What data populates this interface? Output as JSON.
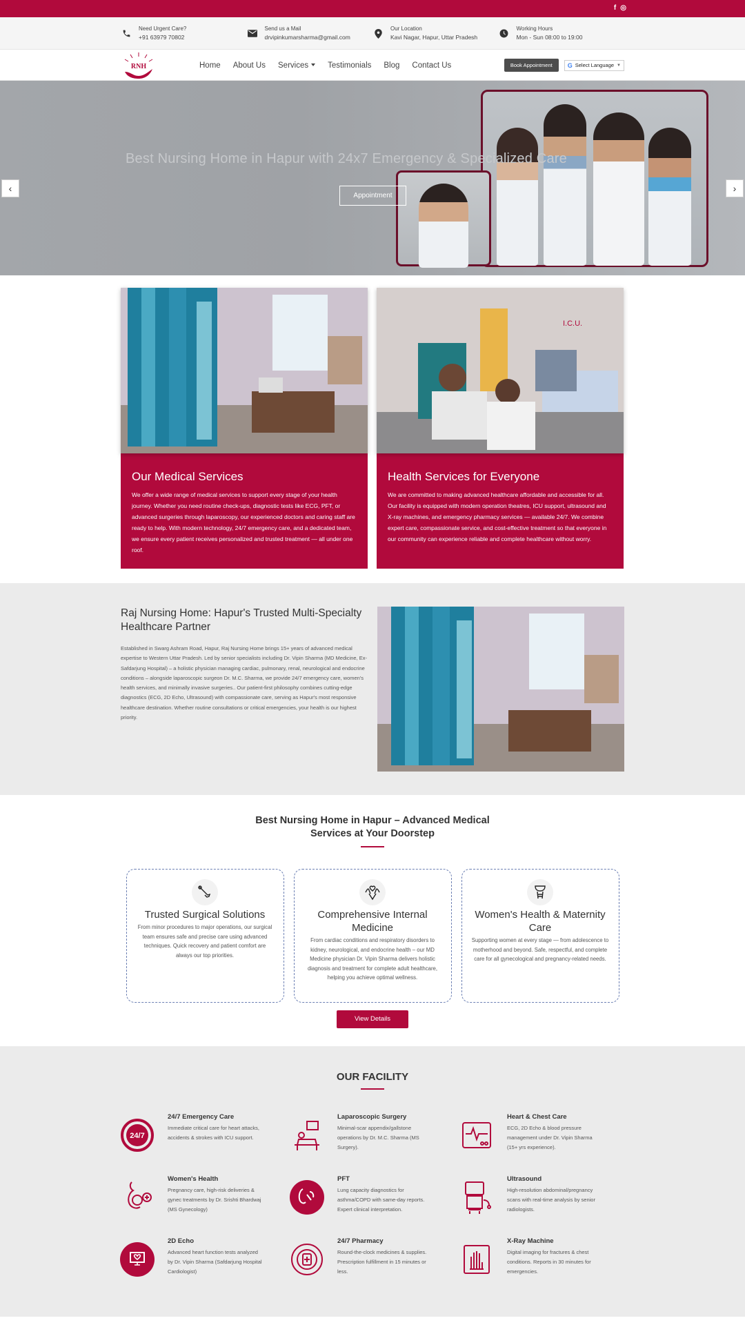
{
  "social": {
    "facebook": "f",
    "instagram": "◎"
  },
  "info": [
    {
      "title": "Need Urgent Care?",
      "value": "+91 63979 70802",
      "icon": "phone-icon"
    },
    {
      "title": "Send us a Mail",
      "value": "drvipinkumarsharma@gmail.com",
      "icon": "mail-icon"
    },
    {
      "title": "Our Location",
      "value": "Kavi Nagar, Hapur, Uttar Pradesh",
      "icon": "location-icon"
    },
    {
      "title": "Working Hours",
      "value": "Mon - Sun 08:00 to 19:00",
      "icon": "clock-icon"
    }
  ],
  "nav": {
    "logo_text": "RNH",
    "items": [
      "Home",
      "About Us",
      "Services",
      "Testimonials",
      "Blog",
      "Contact Us"
    ],
    "book": "Book Appointment",
    "lang": "Select Language",
    "lang_arrow": "▼"
  },
  "hero": {
    "title": "Best Nursing Home in Hapur with 24x7 Emergency & Specialized Care",
    "button": "Appointment",
    "prev": "‹",
    "next": "›"
  },
  "cards": [
    {
      "title": "Our Medical Services",
      "text": "We offer a wide range of medical services to support every stage of your health journey. Whether you need routine check-ups, diagnostic tests like ECG, PFT, or advanced surgeries through laparoscopy, our experienced doctors and caring staff are ready to help. With modern technology, 24/7 emergency care, and a dedicated team, we ensure every patient receives personalized and trusted treatment — all under one roof."
    },
    {
      "title": "Health Services for Everyone",
      "text": "We are committed to making advanced healthcare affordable and accessible for all. Our facility is equipped with modern operation theatres, ICU support, ultrasound and X-ray machines, and emergency pharmacy services — available 24/7. We combine expert care, compassionate service, and cost-effective treatment so that everyone in our community can experience reliable and complete healthcare without worry."
    }
  ],
  "about": {
    "title": "Raj Nursing Home: Hapur's Trusted Multi-Specialty Healthcare Partner",
    "text": "Established in Swarg Ashram Road, Hapur, Raj Nursing Home brings 15+ years of advanced medical expertise to Western Uttar Pradesh. Led by senior specialists including Dr. Vipin Sharma (MD Medicine, Ex-Safdarjung Hospital) – a holistic physician managing cardiac, pulmonary, renal, neurological and endocrine conditions – alongside laparoscopic surgeon Dr. M.C. Sharma, we provide 24/7 emergency care, women's health services, and minimally invasive surgeries.. Our patient-first philosophy combines cutting-edge diagnostics (ECG, 2D Echo, Ultrasound) with compassionate care, serving as Hapur's most responsive healthcare destination. Whether routine consultations or critical emergencies, your health is our highest priority."
  },
  "services": {
    "title": "Best Nursing Home in Hapur – Advanced Medical Services at Your Doorstep",
    "items": [
      {
        "title": "Trusted Surgical Solutions",
        "text": "From minor procedures to major operations, our surgical team ensures safe and precise care using advanced techniques. Quick recovery and patient comfort are always our top priorities.",
        "icon": "scalpel-icon"
      },
      {
        "title": "Comprehensive Internal Medicine",
        "text": "From cardiac conditions and respiratory disorders to kidney, neurological, and endocrine health – our MD Medicine physician Dr. Vipin Sharma delivers holistic diagnosis and treatment for complete adult healthcare, helping you achieve optimal wellness.",
        "icon": "hands-care-icon"
      },
      {
        "title": "Women's Health & Maternity Care",
        "text": "Supporting women at every stage — from adolescence to motherhood and beyond. Safe, respectful, and complete care for all gynecological and pregnancy-related needs.",
        "icon": "tooth-icon"
      }
    ],
    "button": "View Details"
  },
  "facility": {
    "title": "OUR FACILITY",
    "items": [
      {
        "title": "24/7 Emergency Care",
        "text": "Immediate critical care for heart attacks, accidents & strokes with ICU support.",
        "icon": "emergency-247-icon"
      },
      {
        "title": "Laparoscopic Surgery",
        "text": "Minimal-scar appendix/gallstone operations by Dr. M.C. Sharma (MS Surgery).",
        "icon": "surgery-icon"
      },
      {
        "title": "Heart & Chest Care",
        "text": "ECG, 2D Echo & blood pressure management under Dr. Vipin Sharma (15+ yrs experience).",
        "icon": "ecg-monitor-icon"
      },
      {
        "title": "Women's Health",
        "text": "Pregnancy care, high-risk deliveries & gynec treatments by Dr. Srishti Bhardwaj (MS Gynecology)",
        "icon": "pregnancy-icon"
      },
      {
        "title": "PFT",
        "text": "Lung capacity diagnostics for asthma/COPD with same-day reports. Expert clinical interpretation.",
        "icon": "lungs-icon"
      },
      {
        "title": "Ultrasound",
        "text": "High-resolution abdominal/pregnancy scans with real-time analysis by senior radiologists.",
        "icon": "ultrasound-machine-icon"
      },
      {
        "title": "2D Echo",
        "text": "Advanced heart function tests analyzed by Dr. Vipin Sharma (Safdarjung Hospital Cardiologist)",
        "icon": "heart-monitor-icon"
      },
      {
        "title": "24/7 Pharmacy",
        "text": "Round-the-clock medicines & supplies. Prescription fulfillment in 15 minutes or less.",
        "icon": "pharmacy-icon"
      },
      {
        "title": "X-Ray Machine",
        "text": "Digital imaging for fractures & chest conditions. Reports in 30 minutes for emergencies.",
        "icon": "xray-icon"
      }
    ]
  },
  "colors": {
    "brand": "#b10a3c",
    "dark": "#4d4d4d",
    "bg_gray": "#ebebeb"
  }
}
